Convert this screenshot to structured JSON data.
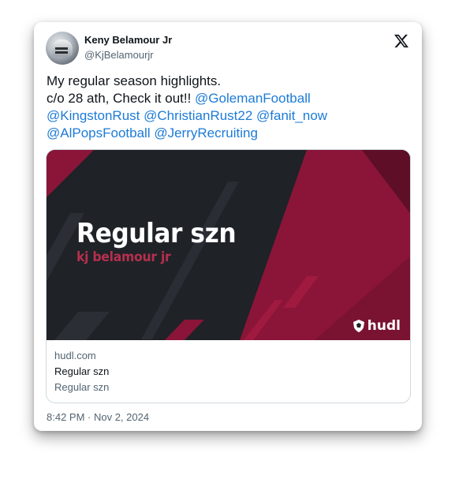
{
  "author": {
    "name": "Keny Belamour Jr",
    "handle": "@KjBelamourjr",
    "avatar_icon": "profile-photo"
  },
  "platform_icon": "x-logo-icon",
  "tweet": {
    "line1": "My regular season highlights.",
    "line2_text": "c/o 28 ath, Check it out!! ",
    "mentions": [
      "@GolemanFootball",
      "@KingstonRust",
      "@ChristianRust22",
      "@fanit_now",
      "@AlPopsFootball",
      "@JerryRecruiting"
    ]
  },
  "link_card": {
    "image_title": "Regular szn",
    "image_subtitle": "kj belamour jr",
    "brand": "hudl",
    "domain": "hudl.com",
    "title": "Regular szn",
    "description": "Regular szn"
  },
  "timestamp": "8:42 PM · Nov 2, 2024",
  "colors": {
    "mention": "#1d7bd7",
    "image_background": "#1f2227",
    "accent_red": "#8a1538",
    "subtitle_red": "#b52f4e"
  }
}
